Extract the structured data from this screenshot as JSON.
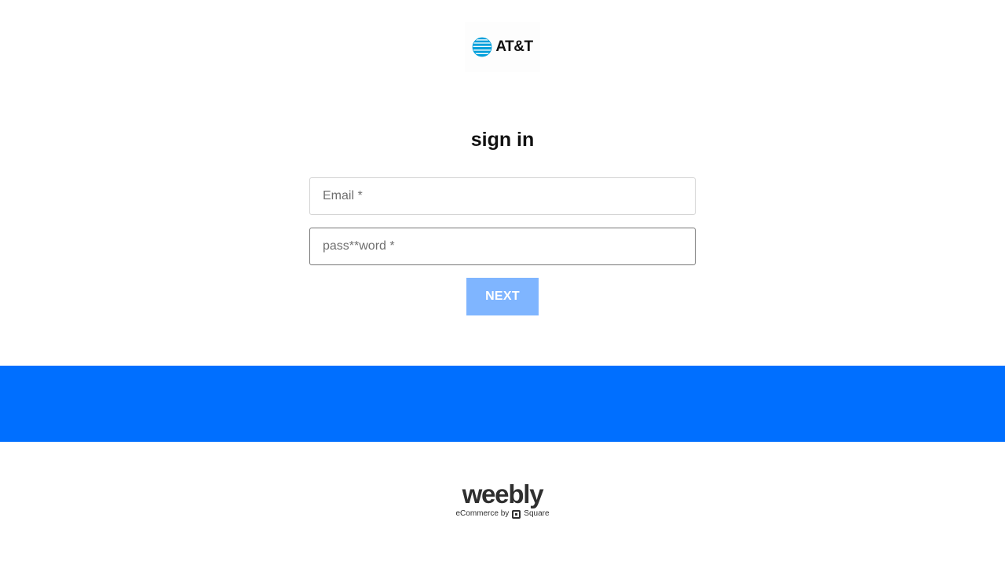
{
  "header": {
    "logo_text": "AT&T",
    "logo_icon": "att-globe-icon"
  },
  "form": {
    "title": "sign in",
    "email_placeholder": "Email *",
    "password_placeholder": "pass**word *",
    "next_label": "NEXT"
  },
  "footer": {
    "brand_name": "weebly",
    "tagline_prefix": "eCommerce by",
    "tagline_brand": "Square",
    "tagline_icon": "square-logo-icon"
  },
  "colors": {
    "accent_band": "#006fff",
    "button_bg": "#7fb5ff",
    "globe_blue": "#009fdb"
  }
}
